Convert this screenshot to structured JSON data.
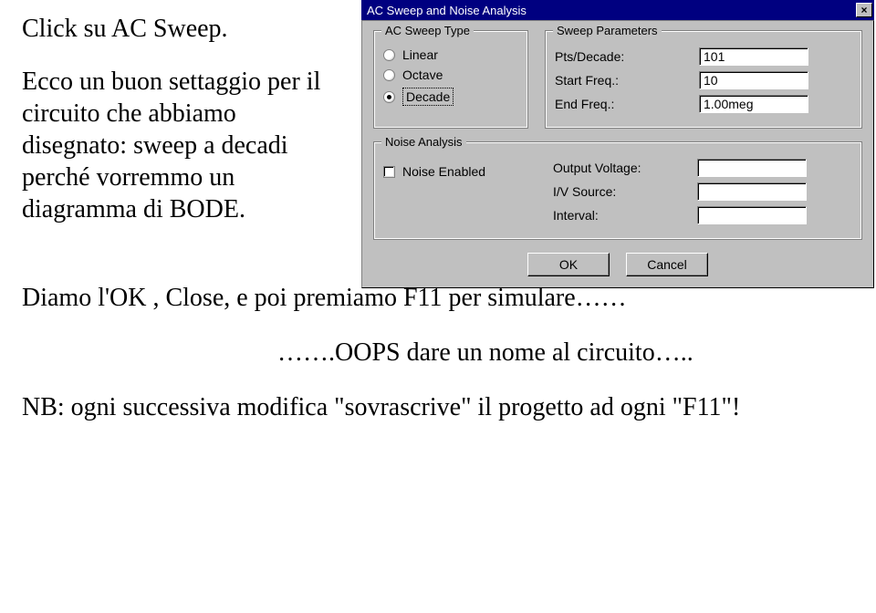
{
  "doc": {
    "heading": "Click su AC Sweep.",
    "para1": "Ecco un buon settaggio per il circuito che abbiamo disegnato: sweep a decadi perché vorremmo un diagramma di BODE.",
    "para2": "Diamo l'OK , Close, e poi premiamo F11 per simulare……",
    "para3": "…….OOPS  dare un nome al circuito…..",
    "para4": "NB: ogni successiva modifica \"sovrascrive\" il progetto ad ogni \"F11\"!"
  },
  "dialog": {
    "title": "AC Sweep and Noise Analysis",
    "close_glyph": "×",
    "sweep_type": {
      "legend": "AC Sweep Type",
      "options": {
        "linear": "Linear",
        "octave": "Octave",
        "decade": "Decade"
      },
      "selected": "decade"
    },
    "params": {
      "legend": "Sweep Parameters",
      "pts_decade_label": "Pts/Decade:",
      "pts_decade_value": "101",
      "start_label": "Start Freq.:",
      "start_value": "10",
      "end_label": "End Freq.:",
      "end_value": "1.00meg"
    },
    "noise": {
      "legend": "Noise Analysis",
      "enabled_label": "Noise Enabled",
      "output_label": "Output Voltage:",
      "output_value": "",
      "iv_label": "I/V Source:",
      "iv_value": "",
      "interval_label": "Interval:",
      "interval_value": ""
    },
    "buttons": {
      "ok": "OK",
      "cancel": "Cancel"
    }
  }
}
